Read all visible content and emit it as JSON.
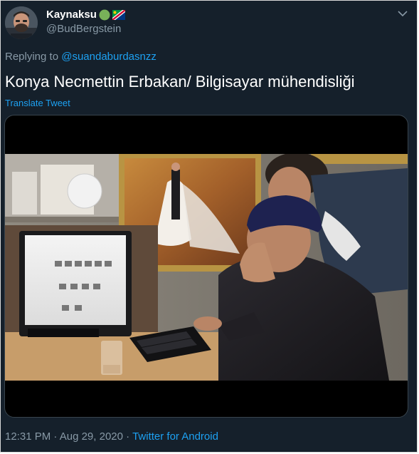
{
  "author": {
    "display_name": "Kaynaksu",
    "handle": "@BudBergstein",
    "badges": [
      "green-circle-emoji",
      "namibia-flag-emoji"
    ]
  },
  "reply": {
    "prefix": "Replying to",
    "to": "@suandaburdasnzz"
  },
  "tweet": {
    "text": "Konya Necmettin Erbakan/ Bilgisayar mühendisliği",
    "translate_label": "Translate Tweet",
    "media": {
      "kind": "photo"
    }
  },
  "footer": {
    "time": "12:31 PM",
    "sep1": "·",
    "date": "Aug 29, 2020",
    "sep2": "·",
    "app": "Twitter for Android"
  },
  "colors": {
    "background": "#15202b",
    "text": "#ffffff",
    "secondary": "#8899a6",
    "accent": "#1da1f2"
  },
  "icons": {
    "menu": "chevron-down-icon"
  }
}
